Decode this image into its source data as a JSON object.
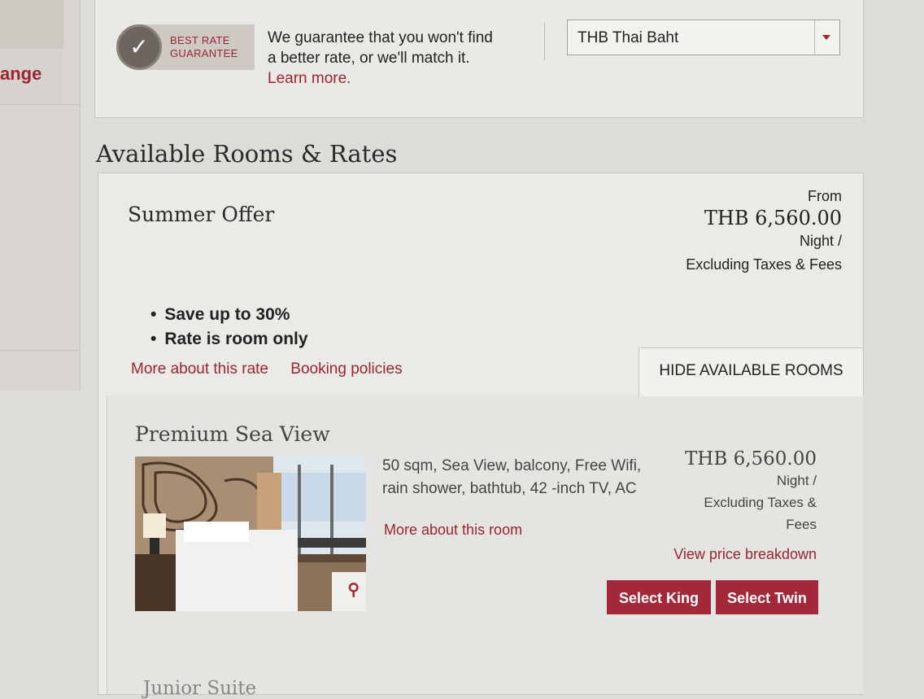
{
  "sidebar": {
    "partial_text": "ange"
  },
  "guarantee": {
    "badge_line1": "BEST RATE",
    "badge_line2": "GUARANTEE",
    "text": "We guarantee that you won't find a better rate, or we'll match it.",
    "link": "Learn more."
  },
  "currency": {
    "selected": "THB Thai Baht"
  },
  "section_title": "Available Rooms & Rates",
  "offer": {
    "title": "Summer Offer",
    "from_label": "From",
    "price": "THB 6,560.00",
    "per_night": "Night /",
    "excluding": "Excluding Taxes & Fees",
    "bullets": [
      "Save up to 30%",
      "Rate is room only"
    ],
    "more_link": "More about this rate",
    "policies_link": "Booking policies",
    "hide_rooms": "HIDE AVAILABLE ROOMS"
  },
  "room": {
    "title": "Premium Sea View",
    "description": "50 sqm, Sea View, balcony, Free Wifi, rain shower, bathtub, 42 -inch TV, AC",
    "more_link": "More about this room",
    "price": "THB 6,560.00",
    "per_night": "Night /",
    "excluding_1": "Excluding Taxes &",
    "excluding_2": "Fees",
    "price_breakdown": "View price breakdown",
    "select_king": "Select King",
    "select_twin": "Select Twin"
  },
  "next_room": {
    "title_partial": "Junior Suite"
  },
  "colors": {
    "accent": "#9b2531",
    "button": "#a3293a"
  }
}
